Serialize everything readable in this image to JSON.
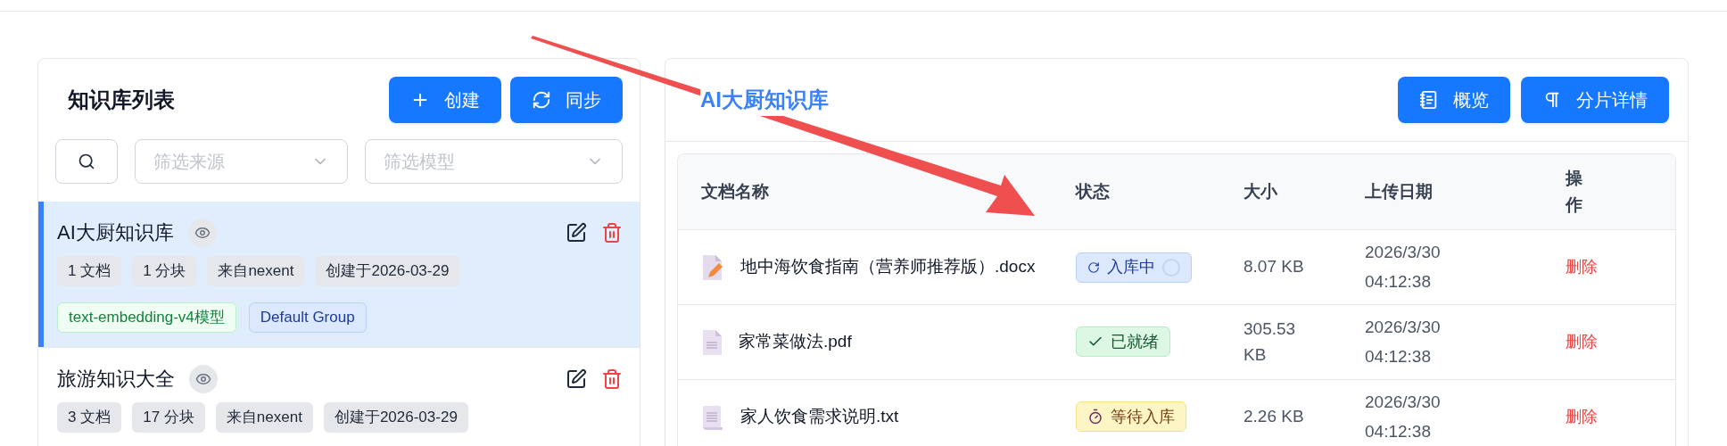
{
  "sidebar": {
    "title": "知识库列表",
    "buttons": [
      {
        "kind": "create",
        "label": "创建"
      },
      {
        "kind": "sync",
        "label": "同步"
      }
    ],
    "filters": [
      {
        "placeholder": "筛选来源"
      },
      {
        "placeholder": "筛选模型"
      }
    ],
    "items": [
      {
        "name": "AI大厨知识库",
        "selected": true,
        "stats": [
          "1 文档",
          "1 分块",
          "来自nexent",
          "创建于2026-03-29"
        ],
        "model": "text-embedding-v4模型",
        "group": "Default Group"
      },
      {
        "name": "旅游知识大全",
        "selected": false,
        "stats": [
          "3 文档",
          "17 分块",
          "来自nexent",
          "创建于2026-03-29"
        ]
      }
    ]
  },
  "detail": {
    "title": "AI大厨知识库",
    "buttons": [
      {
        "kind": "overview",
        "label": "概览"
      },
      {
        "kind": "chunks",
        "label": "分片详情"
      }
    ],
    "table": {
      "columns": [
        "文档名称",
        "状态",
        "大小",
        "上传日期",
        "操作"
      ],
      "rows": [
        {
          "kind": "docx",
          "name": "地中海饮食指南（营养师推荐版）.docx",
          "status": {
            "kind": "processing",
            "label": "入库中"
          },
          "size": "8.07 KB",
          "date": "2026/3/30 04:12:38",
          "action": "删除"
        },
        {
          "kind": "pdf",
          "name": "家常菜做法.pdf",
          "status": {
            "kind": "ready",
            "label": "已就绪"
          },
          "size": "305.53 KB",
          "date": "2026/3/30 04:12:38",
          "action": "删除"
        },
        {
          "kind": "txt",
          "name": "家人饮食需求说明.txt",
          "status": {
            "kind": "waiting",
            "label": "等待入库"
          },
          "size": "2.26 KB",
          "date": "2026/3/30 04:12:38",
          "action": "删除"
        }
      ]
    }
  }
}
